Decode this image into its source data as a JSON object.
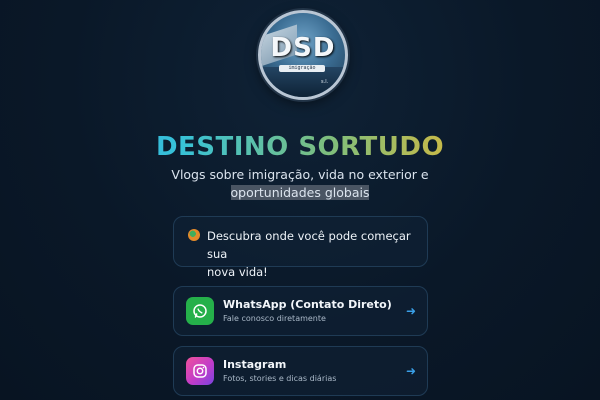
{
  "logo": {
    "text": "DSD",
    "search_text": "imigração",
    "sub": "s.l."
  },
  "title": "DESTINO SORTUDO",
  "tagline": {
    "line1": "Vlogs sobre imigração, vida no exterior e",
    "line2_highlight": "oportunidades globais"
  },
  "info_card": {
    "line1": "Descubra onde você pode começar sua",
    "line2": "nova vida!",
    "icon": "globe-icon"
  },
  "links": [
    {
      "title": "WhatsApp (Contato Direto)",
      "subtitle": "Fale conosco diretamente",
      "icon": "whatsapp-icon",
      "color": "#25b04a"
    },
    {
      "title": "Instagram",
      "subtitle": "Fotos, stories e dicas diárias",
      "icon": "instagram-icon",
      "color": "#c23cc9"
    }
  ],
  "colors": {
    "background": "#0a1828",
    "accent": "#3aa0e8"
  }
}
